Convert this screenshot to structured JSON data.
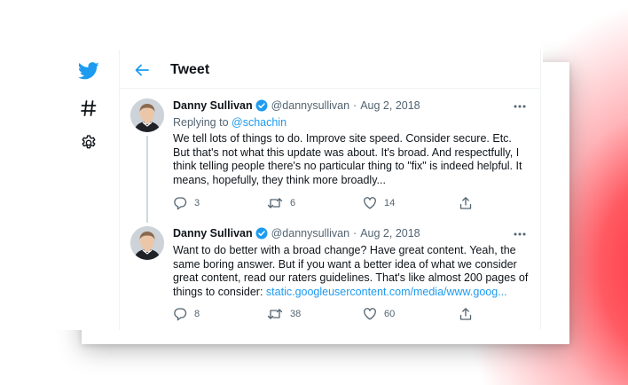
{
  "header": {
    "title": "Tweet"
  },
  "sidebar": {
    "items": [
      {
        "icon": "twitter-logo-icon"
      },
      {
        "icon": "hashtag-icon"
      },
      {
        "icon": "gear-icon"
      }
    ]
  },
  "tweets": [
    {
      "author": "Danny Sullivan",
      "handle": "@dannysullivan",
      "separator": "·",
      "date": "Aug 2, 2018",
      "replying_prefix": "Replying to ",
      "replying_to": "@schachin",
      "text": "We tell lots of things to do. Improve site speed. Consider secure. Etc. But that's not what this update was about. It's broad. And respectfully, I think telling people there's no particular thing to \"fix\" is indeed helpful. It means, hopefully, they think more broadly...",
      "replies": "3",
      "retweets": "6",
      "likes": "14"
    },
    {
      "author": "Danny Sullivan",
      "handle": "@dannysullivan",
      "separator": "·",
      "date": "Aug 2, 2018",
      "text": "Want to do better with a broad change? Have great content. Yeah, the same boring answer. But if you want a better idea of what we consider great content, read our raters guidelines. That's like almost 200 pages of things to consider: ",
      "link": "static.googleusercontent.com/media/www.goog...",
      "replies": "8",
      "retweets": "38",
      "likes": "60"
    }
  ],
  "colors": {
    "accent": "#1d9bf0",
    "text_primary": "#0f1419",
    "text_secondary": "#536471",
    "glow": "#ff2b3a"
  }
}
